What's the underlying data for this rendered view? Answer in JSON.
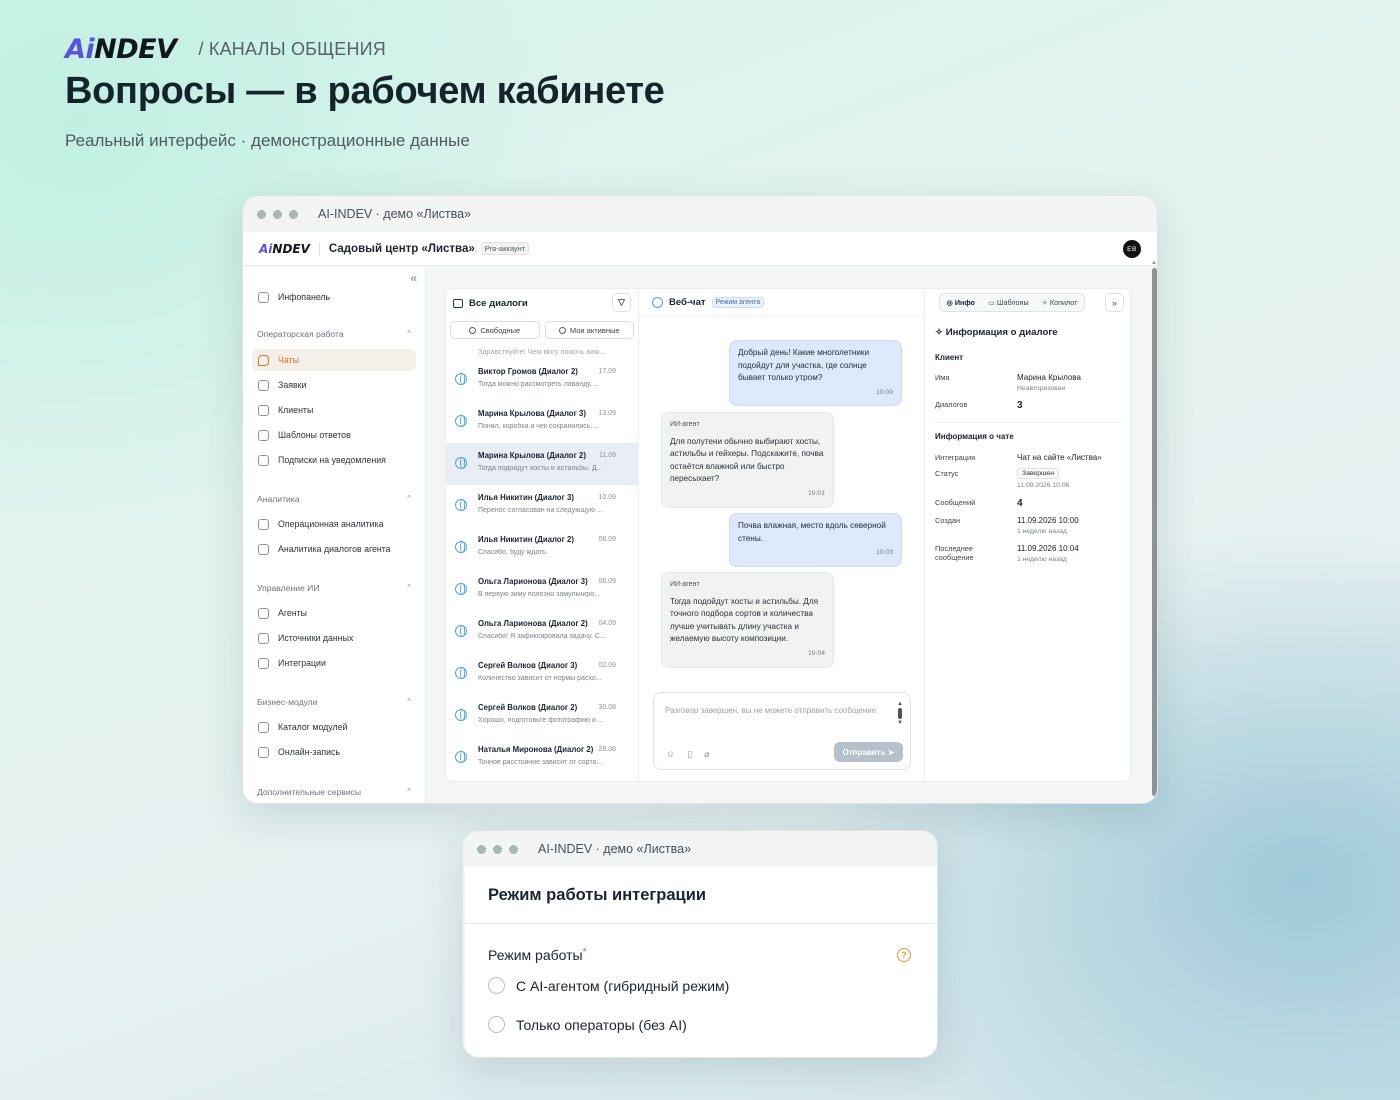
{
  "hero": {
    "logo_ai": "Ai",
    "logo_rest": "NDEV",
    "crumb": "/ КАНАЛЫ ОБЩЕНИЯ",
    "title": "Вопросы — в рабочем кабинете",
    "subtitle": "Реальный интерфейс · демонстрационные данные"
  },
  "main_window": {
    "title": "AI-INDEV · демо «Листва»",
    "header": {
      "logo_ai": "Ai",
      "logo_rest": "NDEV",
      "org": "Садовый центр «Листва»",
      "badge": "Pro-аккаунт",
      "avatar": "ЕВ"
    },
    "sidebar": {
      "collapse_icon": "double-chevron-left-icon",
      "top_item": "Инфопанель",
      "groups": [
        {
          "label": "Операторская работа",
          "items": [
            "Чаты",
            "Заявки",
            "Клиенты",
            "Шаблоны ответов",
            "Подписки на уведомления"
          ]
        },
        {
          "label": "Аналитика",
          "items": [
            "Операционная аналитика",
            "Аналитика диалогов агента"
          ]
        },
        {
          "label": "Управление ИИ",
          "items": [
            "Агенты",
            "Источники данных",
            "Интеграции"
          ]
        },
        {
          "label": "Бизнес-модули",
          "items": [
            "Каталог модулей",
            "Онлайн-запись"
          ]
        },
        {
          "label": "Дополнительные сервисы",
          "items": []
        }
      ],
      "active_item": "Чаты"
    },
    "dialogs": {
      "title": "Все диалоги",
      "filters": [
        "Свободные",
        "Мои активные"
      ],
      "top_ghost": "Здравствуйте! Чем могу помочь вам...",
      "items": [
        {
          "name": "Виктор Громов (Диалог 2)",
          "date": "17.09",
          "preview": "Тогда можно рассмотреть лаванду, ..."
        },
        {
          "name": "Марина Крылова (Диалог 3)",
          "date": "13.09",
          "preview": "Понял, коробка и чек сохранились...."
        },
        {
          "name": "Марина Крылова (Диалог 2)",
          "date": "11.09",
          "preview": "Тогда подойдут хосты и астильбы. Д..."
        },
        {
          "name": "Илья Никитин (Диалог 3)",
          "date": "10.09",
          "preview": "Перенос согласован на следующую ..."
        },
        {
          "name": "Илья Никитин (Диалог 2)",
          "date": "08.09",
          "preview": "Спасибо, буду ждать."
        },
        {
          "name": "Ольга Ларионова (Диалог 3)",
          "date": "06.09",
          "preview": "В первую зиму полезно замульчиро..."
        },
        {
          "name": "Ольга Ларионова (Диалог 2)",
          "date": "04.09",
          "preview": "Спасибо! Я зафиксировала задачу. С..."
        },
        {
          "name": "Сергей Волков (Диалог 3)",
          "date": "02.09",
          "preview": "Количество зависит от нормы расхо..."
        },
        {
          "name": "Сергей Волков (Диалог 2)",
          "date": "30.08",
          "preview": "Хорошо, подготовьте фотографию и ..."
        },
        {
          "name": "Наталья Миронова (Диалог 2)",
          "date": "28.08",
          "preview": "Точное расстояние зависит от сорта..."
        }
      ]
    },
    "chat": {
      "title": "Веб-чат",
      "badge": "Режим агента",
      "messages": [
        {
          "role": "user",
          "text": "Добрый день! Какие многолетники подойдут для участка, где солнце бывает только утром?",
          "time": "10:00"
        },
        {
          "role": "ai",
          "author": "ИИ-агент",
          "text": "Для полутени обычно выбирают хосты, астильбы и гейхеры. Подскажите, почва остаётся влажной или быстро пересыхает?",
          "time": "10:01"
        },
        {
          "role": "user",
          "text": "Почва влажная, место вдоль северной стены.",
          "time": "10:03"
        },
        {
          "role": "ai",
          "author": "ИИ-агент",
          "text": "Тогда подойдут хосты и астильбы. Для точного подбора сортов и количества лучше учитывать длину участка и желаемую высоту композиции.",
          "time": "10:04"
        }
      ],
      "composer_placeholder": "Разговор завершен, вы не можете отправить сообщение",
      "send_label": "Отправить"
    },
    "info": {
      "tabs": [
        "Инфо",
        "Шаблоны",
        "Копилот"
      ],
      "title": "Информация о диалоге",
      "client_section": "Клиент",
      "name_label": "Имя",
      "name_value": "Марина Крылова",
      "name_sub": "Неавторизован",
      "dialogs_label": "Диалогов",
      "dialogs_value": "3",
      "chat_section": "Информация о чате",
      "integration_label": "Интеграция",
      "integration_value": "Чат на сайте «Листва»",
      "status_label": "Статус",
      "status_value": "Завершен",
      "status_time": "11.09.2026 10:06",
      "messages_label": "Сообщений",
      "messages_value": "4",
      "created_label": "Создан",
      "created_value": "11.09.2026 10:00",
      "created_sub": "1 неделю назад",
      "last_label": "Последнее сообщение",
      "last_value": "11.09.2026 10:04",
      "last_sub": "1 неделю назад"
    }
  },
  "modal_window": {
    "title": "AI-INDEV · демо «Листва»",
    "heading": "Режим работы интеграции",
    "field_label": "Режим работы",
    "required_mark": "*",
    "help": "?",
    "options": [
      "С AI-агентом (гибридный режим)",
      "Только операторы (без AI)"
    ]
  },
  "colors": {
    "accent": "#d97524",
    "brand_purple": "#5a52d9",
    "user_bubble": "#dde8fb",
    "ai_bubble": "#f1f2f2"
  }
}
